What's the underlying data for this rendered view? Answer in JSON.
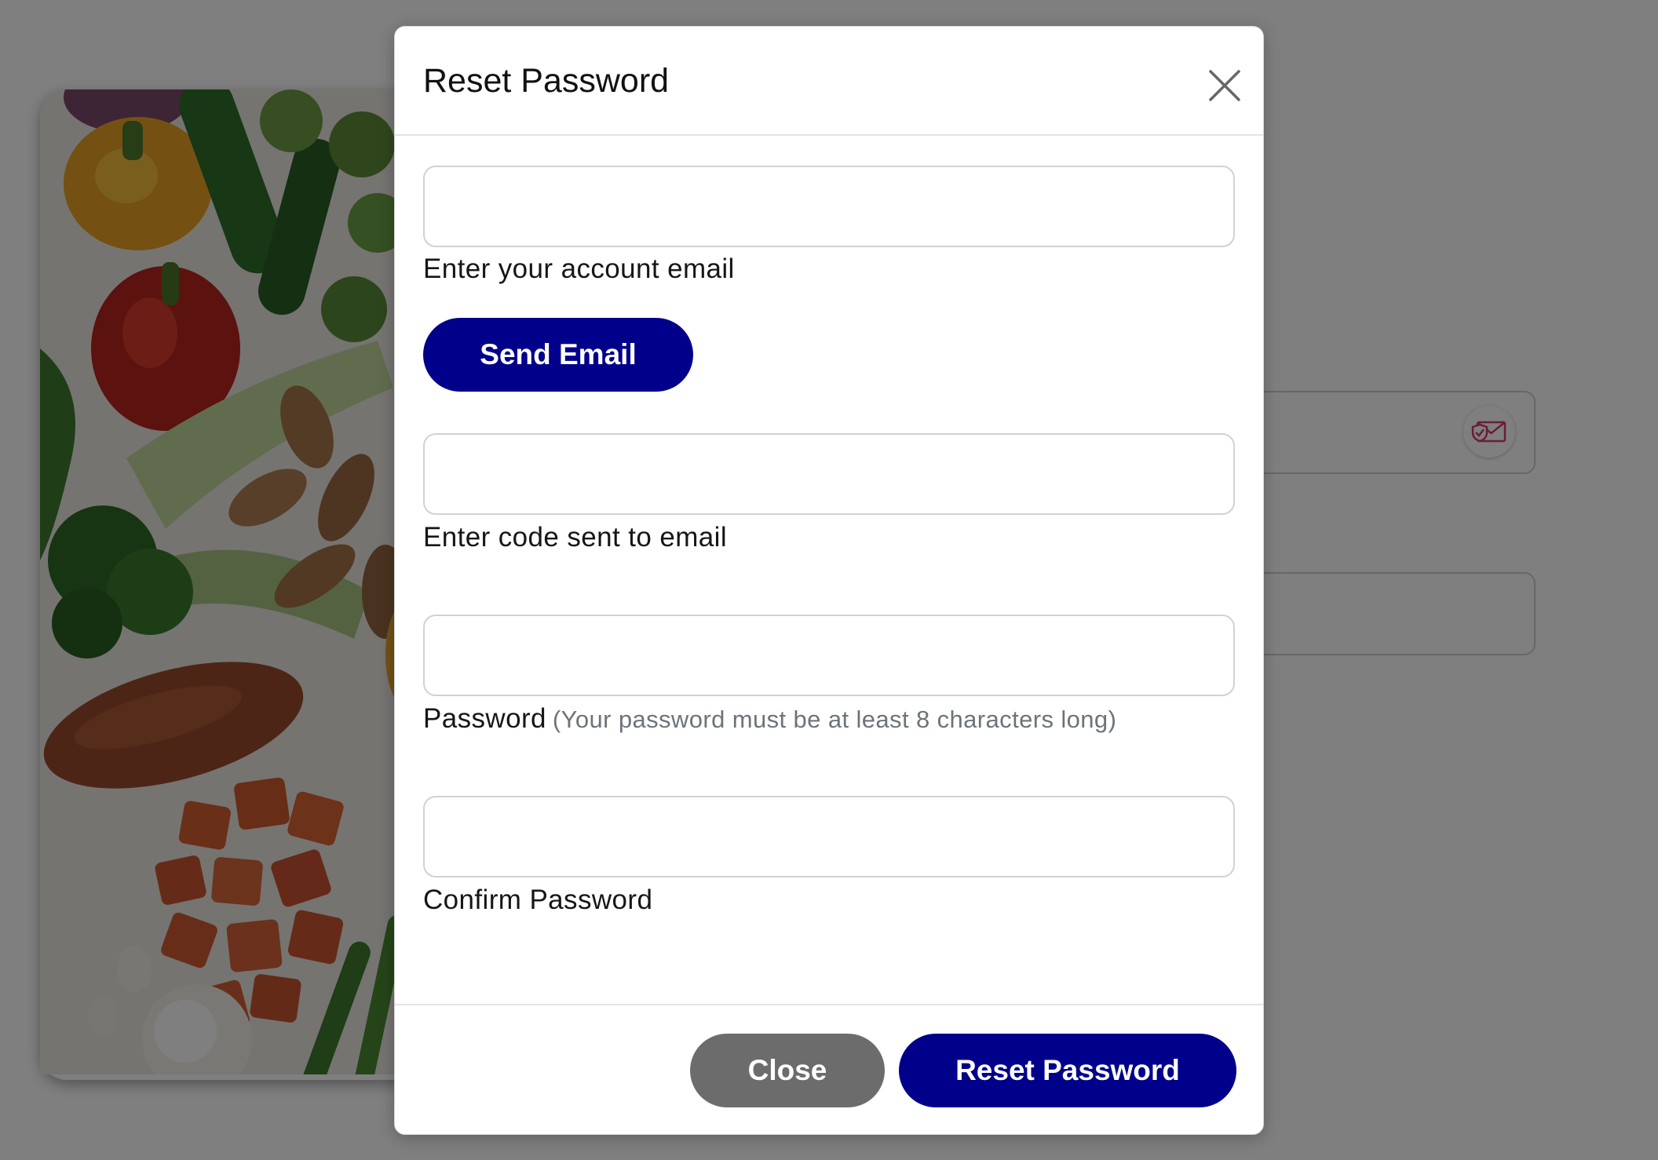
{
  "modal": {
    "title": "Reset Password",
    "close_icon": "close-icon",
    "email_label": "Enter your account email",
    "email_value": "",
    "send_email_label": "Send Email",
    "code_label": "Enter code sent to email",
    "code_value": "",
    "password_label": "Password",
    "password_hint": "(Your password must be at least 8 characters long)",
    "password_value": "",
    "confirm_password_label": "Confirm Password",
    "confirm_password_value": "",
    "close_button_label": "Close",
    "reset_button_label": "Reset Password"
  },
  "background": {
    "hero_image": "vegetables-photo",
    "email_badge_icon": "shield-envelope-icon"
  },
  "colors": {
    "primary": "#00008b",
    "secondary": "#6c6c6c",
    "backdrop": "rgba(0,0,0,0.5)",
    "badge_accent": "#d63b73"
  }
}
